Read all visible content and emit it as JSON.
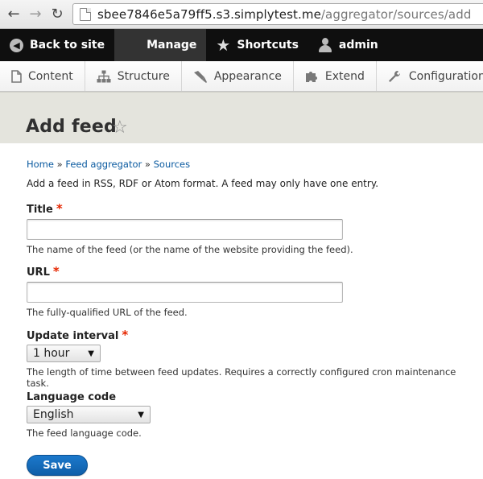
{
  "browser": {
    "url_host": "sbee7846e5a79ff5.s3.simplytest.me",
    "url_path": "/aggregator/sources/add"
  },
  "toolbar": {
    "back_label": "Back to site",
    "manage_label": "Manage",
    "shortcuts_label": "Shortcuts",
    "user_label": "admin"
  },
  "tray": {
    "items": [
      {
        "label": "Content",
        "icon": "file-icon"
      },
      {
        "label": "Structure",
        "icon": "sitemap-icon"
      },
      {
        "label": "Appearance",
        "icon": "paintbrush-icon"
      },
      {
        "label": "Extend",
        "icon": "puzzle-icon"
      },
      {
        "label": "Configuration",
        "icon": "wrench-icon"
      }
    ]
  },
  "page": {
    "title": "Add feed"
  },
  "breadcrumb": {
    "items": [
      "Home",
      "Feed aggregator",
      "Sources"
    ],
    "separator": "»"
  },
  "intro": "Add a feed in RSS, RDF or Atom format. A feed may only have one entry.",
  "form": {
    "title_field": {
      "label": "Title",
      "required_mark": "*",
      "value": "",
      "description": "The name of the feed (or the name of the website providing the feed)."
    },
    "url_field": {
      "label": "URL",
      "required_mark": "*",
      "value": "",
      "description": "The fully-qualified URL of the feed."
    },
    "update_interval": {
      "label": "Update interval",
      "required_mark": "*",
      "selected": "1 hour",
      "description": "The length of time between feed updates. Requires a correctly configured cron maintenance task."
    },
    "language": {
      "label": "Language code",
      "selected": "English",
      "description": "The feed language code."
    },
    "submit_label": "Save"
  },
  "colors": {
    "toolbar_bg": "#0f0f0f",
    "page_head_bg": "#e4e4dd",
    "link": "#0a5aa0",
    "required": "#e62600",
    "primary_button": "#0f5ea8"
  }
}
